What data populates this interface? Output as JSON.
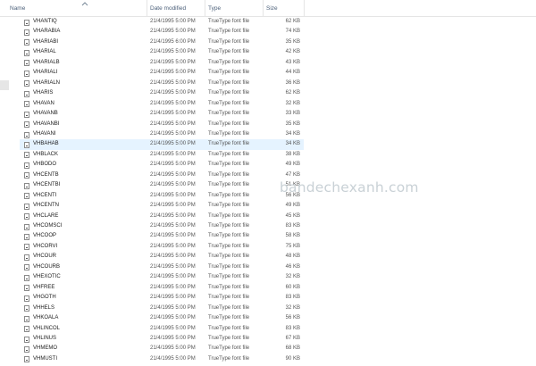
{
  "columns": {
    "name": "Name",
    "date": "Date modified",
    "type": "Type",
    "size": "Size"
  },
  "sort_icon": "chevron-up-icon",
  "file_icon": "font-file-icon",
  "selected_index": 12,
  "files": [
    {
      "name": "VHANTIQ",
      "date": "21/4/1995 5:00 PM",
      "type": "TrueType font file",
      "size": "62 KB"
    },
    {
      "name": "VHARABIA",
      "date": "21/4/1995 5:00 PM",
      "type": "TrueType font file",
      "size": "74 KB"
    },
    {
      "name": "VHARIABI",
      "date": "21/4/1995 6:00 PM",
      "type": "TrueType font file",
      "size": "35 KB"
    },
    {
      "name": "VHARIAL",
      "date": "21/4/1995 5:00 PM",
      "type": "TrueType font file",
      "size": "42 KB"
    },
    {
      "name": "VHARIALB",
      "date": "21/4/1995 5:00 PM",
      "type": "TrueType font file",
      "size": "43 KB"
    },
    {
      "name": "VHARIALI",
      "date": "21/4/1995 5:00 PM",
      "type": "TrueType font file",
      "size": "44 KB"
    },
    {
      "name": "VHARIALN",
      "date": "21/4/1995 5:00 PM",
      "type": "TrueType font file",
      "size": "36 KB"
    },
    {
      "name": "VHARIS",
      "date": "21/4/1995 5:00 PM",
      "type": "TrueType font file",
      "size": "62 KB"
    },
    {
      "name": "VHAVAN",
      "date": "21/4/1995 5:00 PM",
      "type": "TrueType font file",
      "size": "32 KB"
    },
    {
      "name": "VHAVANB",
      "date": "21/4/1995 5:00 PM",
      "type": "TrueType font file",
      "size": "33 KB"
    },
    {
      "name": "VHAVANBI",
      "date": "21/4/1995 5:00 PM",
      "type": "TrueType font file",
      "size": "35 KB"
    },
    {
      "name": "VHAVANI",
      "date": "21/4/1995 5:00 PM",
      "type": "TrueType font file",
      "size": "34 KB"
    },
    {
      "name": "VHBAHAB",
      "date": "21/4/1995 5:00 PM",
      "type": "TrueType font file",
      "size": "34 KB"
    },
    {
      "name": "VHBLACK",
      "date": "21/4/1995 5:00 PM",
      "type": "TrueType font file",
      "size": "38 KB"
    },
    {
      "name": "VHBODO",
      "date": "21/4/1995 5:00 PM",
      "type": "TrueType font file",
      "size": "49 KB"
    },
    {
      "name": "VHCENTB",
      "date": "21/4/1995 5:00 PM",
      "type": "TrueType font file",
      "size": "47 KB"
    },
    {
      "name": "VHCENTBI",
      "date": "21/4/1995 5:00 PM",
      "type": "TrueType font file",
      "size": "51 KB"
    },
    {
      "name": "VHCENTI",
      "date": "21/4/1995 5:00 PM",
      "type": "TrueType font file",
      "size": "56 KB"
    },
    {
      "name": "VHCENTN",
      "date": "21/4/1995 5:00 PM",
      "type": "TrueType font file",
      "size": "49 KB"
    },
    {
      "name": "VHCLARE",
      "date": "21/4/1995 5:00 PM",
      "type": "TrueType font file",
      "size": "45 KB"
    },
    {
      "name": "VHCOMSCI",
      "date": "21/4/1995 5:00 PM",
      "type": "TrueType font file",
      "size": "83 KB"
    },
    {
      "name": "VHCOOP",
      "date": "21/4/1995 5:00 PM",
      "type": "TrueType font file",
      "size": "58 KB"
    },
    {
      "name": "VHCORVI",
      "date": "21/4/1995 5:00 PM",
      "type": "TrueType font file",
      "size": "75 KB"
    },
    {
      "name": "VHCOUR",
      "date": "21/4/1995 5:00 PM",
      "type": "TrueType font file",
      "size": "48 KB"
    },
    {
      "name": "VHCOURB",
      "date": "21/4/1995 5:00 PM",
      "type": "TrueType font file",
      "size": "46 KB"
    },
    {
      "name": "VHEXOTIC",
      "date": "21/4/1995 5:00 PM",
      "type": "TrueType font file",
      "size": "32 KB"
    },
    {
      "name": "VHFREE",
      "date": "21/4/1995 5:00 PM",
      "type": "TrueType font file",
      "size": "60 KB"
    },
    {
      "name": "VHGOTH",
      "date": "21/4/1995 5:00 PM",
      "type": "TrueType font file",
      "size": "83 KB"
    },
    {
      "name": "VHHELS",
      "date": "21/4/1995 5:00 PM",
      "type": "TrueType font file",
      "size": "32 KB"
    },
    {
      "name": "VHKOALA",
      "date": "21/4/1995 5:00 PM",
      "type": "TrueType font file",
      "size": "56 KB"
    },
    {
      "name": "VHLINCOL",
      "date": "21/4/1995 5:00 PM",
      "type": "TrueType font file",
      "size": "83 KB"
    },
    {
      "name": "VHLINUS",
      "date": "21/4/1995 5:00 PM",
      "type": "TrueType font file",
      "size": "67 KB"
    },
    {
      "name": "VHMEMO",
      "date": "21/4/1995 5:00 PM",
      "type": "TrueType font file",
      "size": "68 KB"
    },
    {
      "name": "VHMUSTI",
      "date": "21/4/1995 5:00 PM",
      "type": "TrueType font file",
      "size": "90 KB"
    }
  ],
  "watermark": "bandechexanh.com"
}
